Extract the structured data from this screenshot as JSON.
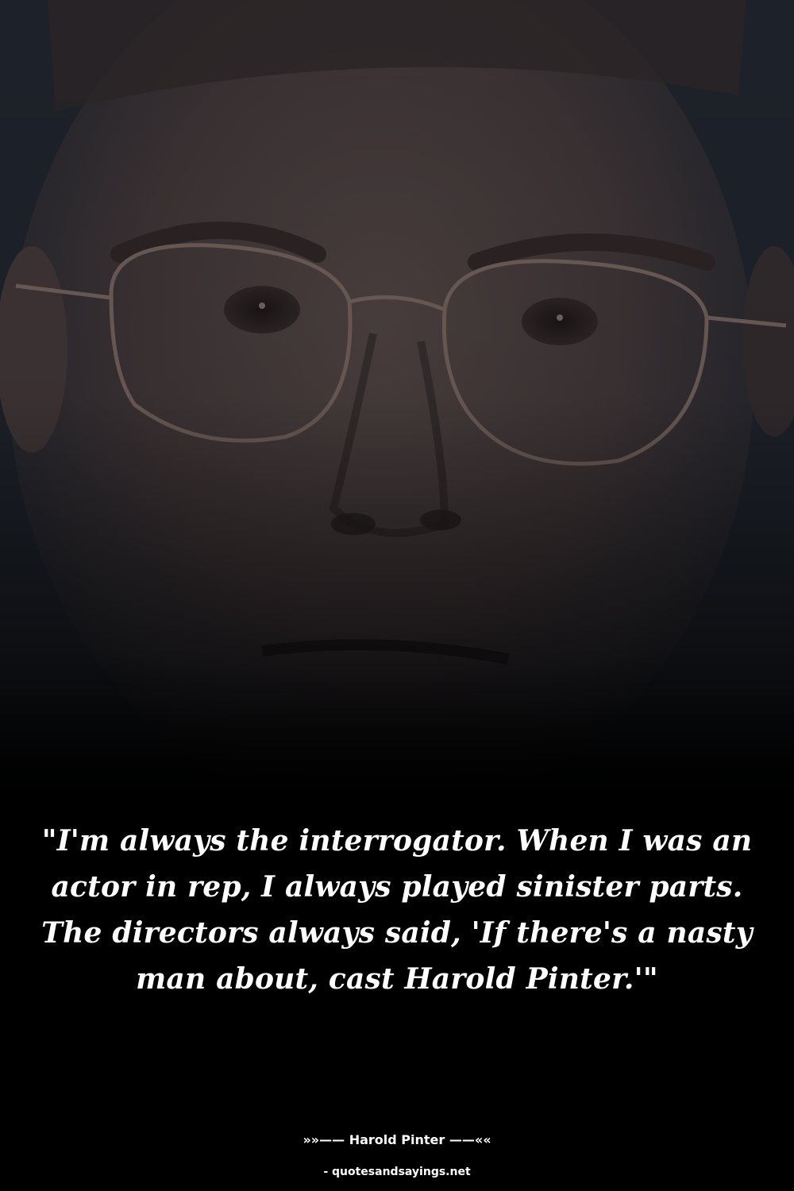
{
  "quote": {
    "text": "\"I'm always the interrogator. When I was an actor in rep, I always played sinister parts. The directors always said, 'If there's a nasty man about, cast Harold Pinter.'\""
  },
  "attribution": {
    "author_line": "»»—— Harold Pinter ——««"
  },
  "footer": {
    "site": "- quotesandsayings.net"
  },
  "colors": {
    "text": "#ffffff",
    "background_bottom": "#000000",
    "background_top": "#1b1f27"
  }
}
